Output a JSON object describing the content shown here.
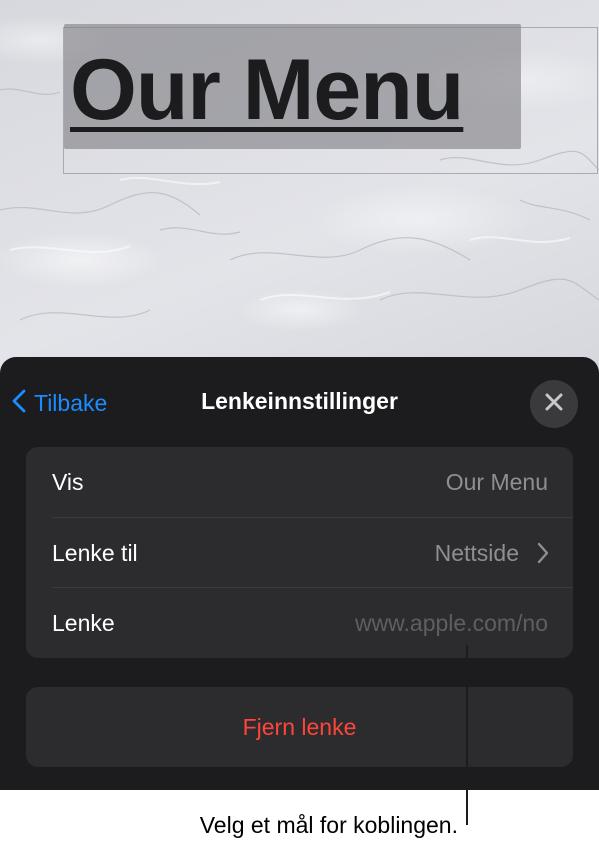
{
  "canvas": {
    "title_text": "Our Menu"
  },
  "sheet": {
    "back_label": "Tilbake",
    "title": "Lenkeinnstillinger"
  },
  "settings_rows": [
    {
      "label": "Vis",
      "value": "Our Menu"
    },
    {
      "label": "Lenke til",
      "value": "Nettside"
    },
    {
      "label": "Lenke",
      "value": "www.apple.com/no"
    }
  ],
  "remove_button_label": "Fjern lenke",
  "callout_text": "Velg et mål for koblingen.",
  "colors": {
    "accent_blue": "#1a8cff",
    "destructive_red": "#ff453a",
    "sheet_background": "#1c1c1e",
    "group_background": "#2c2c2e"
  }
}
